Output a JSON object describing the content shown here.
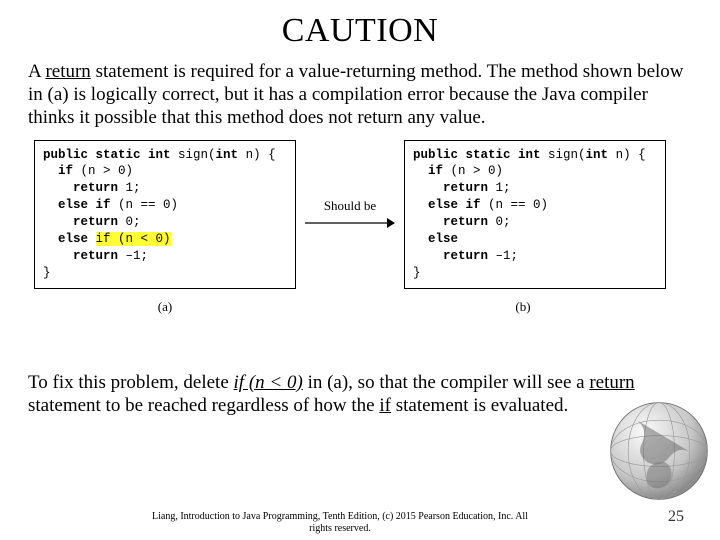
{
  "title": "CAUTION",
  "paragraph1": {
    "pre": "A ",
    "u1": "return",
    "rest": " statement is required for a value-returning method. The method shown below in (a) is logically correct, but it has a compilation error because the Java compiler thinks it possible that this method does not return any value."
  },
  "code_a": {
    "l1a": "public static int ",
    "l1b": "sign(",
    "l1c": "int",
    "l1d": " n) {",
    "l2a": "if",
    "l2b": " (n > 0)",
    "l3a": "return",
    "l3b": " 1;",
    "l4a": "else if",
    "l4b": " (n == 0)",
    "l5a": "return",
    "l5b": " 0;",
    "l6a": "else ",
    "l6hl": "if (n < 0)",
    "l7a": "return",
    "l7b": " –1;",
    "l8": "}"
  },
  "between_label": "Should be",
  "code_b": {
    "l1a": "public static int ",
    "l1b": "sign(",
    "l1c": "int",
    "l1d": " n) {",
    "l2a": "if",
    "l2b": " (n > 0)",
    "l3a": "return",
    "l3b": " 1;",
    "l4a": "else if",
    "l4b": " (n == 0)",
    "l5a": "return",
    "l5b": " 0;",
    "l6a": "else",
    "l7a": "return",
    "l7b": " –1;",
    "l8": "}"
  },
  "caption_a": "(a)",
  "caption_b": "(b)",
  "paragraph2": {
    "pre": "To fix this problem, delete ",
    "ui1": "if (n < 0)",
    "mid1": " in (a), so that the compiler will see a ",
    "u2": "return",
    "mid2": " statement to be reached regardless of how the ",
    "u3": "if",
    "post": " statement is evaluated."
  },
  "footer_line1": "Liang, Introduction to Java Programming, Tenth Edition, (c) 2015 Pearson Education, Inc. All",
  "footer_line2": "rights reserved.",
  "page_number": "25"
}
